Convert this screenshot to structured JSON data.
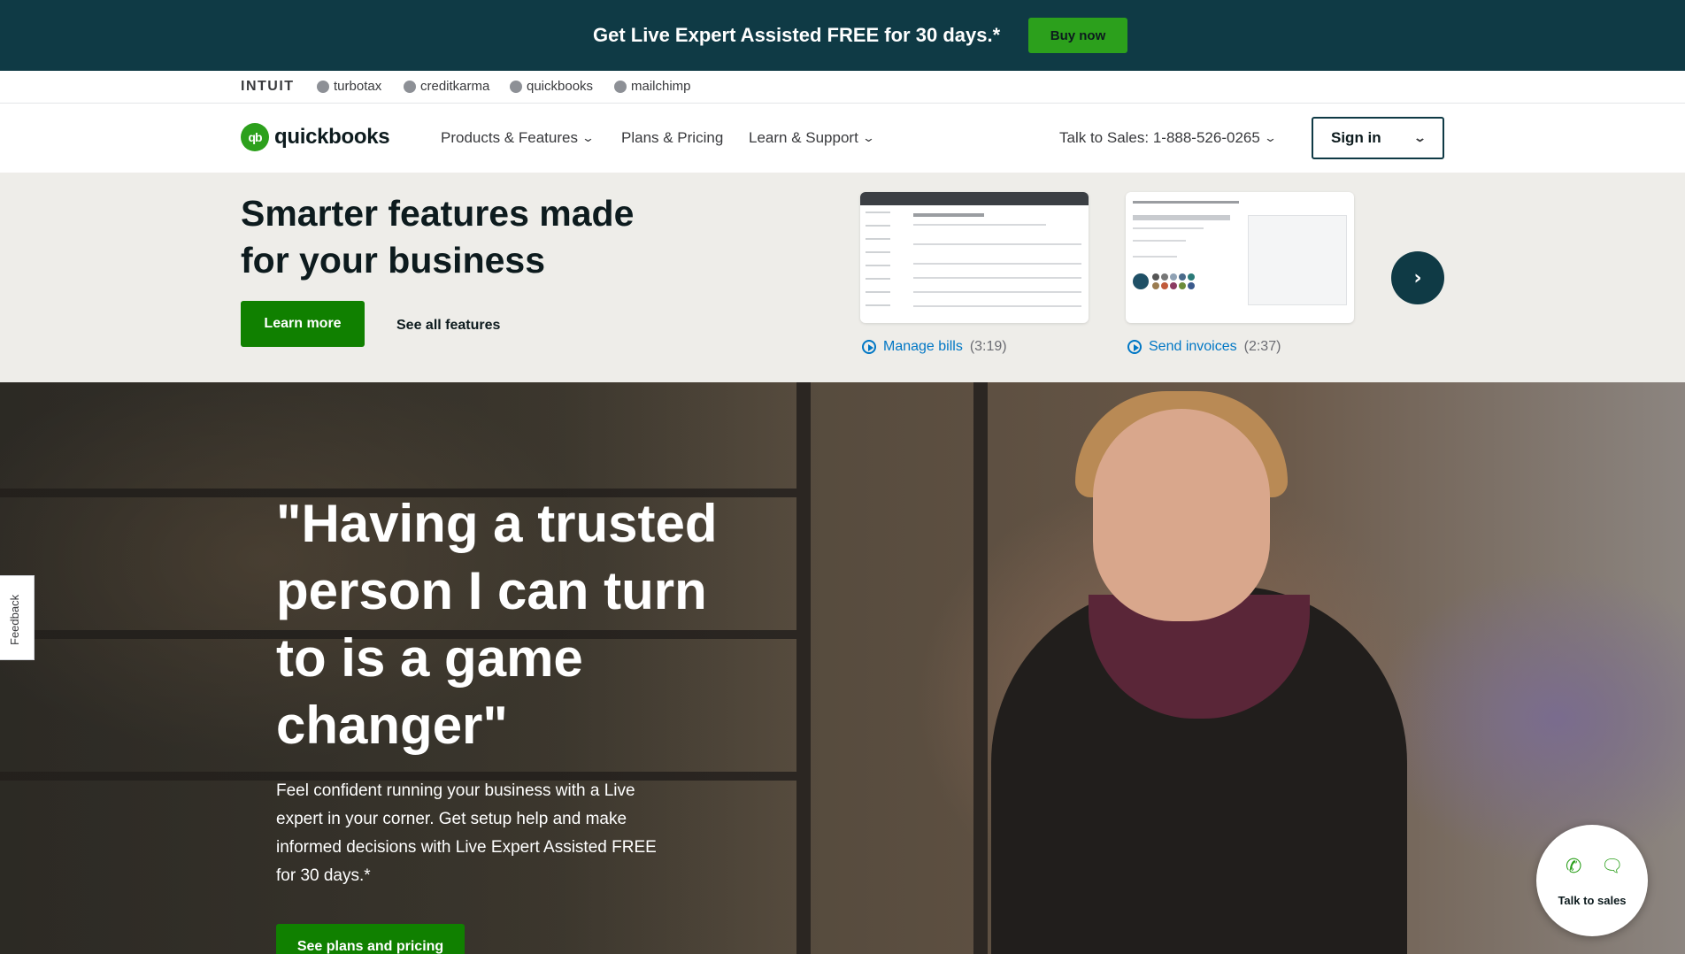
{
  "promo": {
    "text": "Get Live Expert Assisted FREE for 30 days.*",
    "button": "Buy now",
    "bg_color": "#0f3a45",
    "button_color": "#2ca01c"
  },
  "brand_strip": {
    "items": [
      {
        "label": "INTUIT",
        "icon": ""
      },
      {
        "label": "turbotax",
        "icon": "turbotax-icon"
      },
      {
        "label": "creditkarma",
        "icon": "creditkarma-icon"
      },
      {
        "label": "quickbooks",
        "icon": "quickbooks-icon"
      },
      {
        "label": "mailchimp",
        "icon": "mailchimp-icon"
      }
    ]
  },
  "nav": {
    "logo_mark": "qb",
    "logo_text": "quickbooks",
    "items": [
      {
        "label": "Products & Features",
        "dropdown": true
      },
      {
        "label": "Plans & Pricing",
        "dropdown": false
      },
      {
        "label": "Learn & Support",
        "dropdown": true
      }
    ],
    "sales": "Talk to Sales: 1-888-526-0265",
    "signin": "Sign in",
    "chevron": "⌄"
  },
  "features": {
    "title": "Smarter features made for your business",
    "learn_more": "Learn more",
    "see_all": "See all features",
    "videos": [
      {
        "label": "Manage bills",
        "duration": "(3:19)"
      },
      {
        "label": "Send invoices",
        "duration": "(2:37)"
      }
    ],
    "next_icon": "›"
  },
  "hero": {
    "quote": "\"Having a trusted person I can turn to is a game changer\"",
    "body": "Feel confident running your business with a Live expert in your corner. Get setup help and make informed decisions with Live Expert Assisted FREE for 30 days.*",
    "button": "See plans and pricing"
  },
  "feedback": "Feedback",
  "talk": {
    "label": "Talk to sales",
    "phone_icon": "✆",
    "chat_icon": "🗨"
  },
  "colors": {
    "accent_green": "#2ca01c",
    "button_green": "#108000",
    "dark_teal": "#0f3a45",
    "link_blue": "#0077c5"
  }
}
